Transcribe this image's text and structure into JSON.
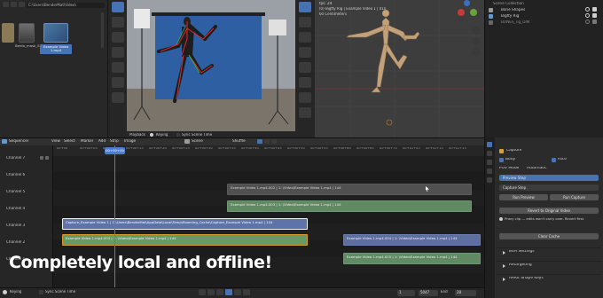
{
  "file_browser": {
    "path": "C:\\Users\\BenderMat\\Video\\",
    "items": [
      {
        "label": "",
        "kind": "folder"
      },
      {
        "label": "Bento_mask_Script",
        "kind": "file"
      },
      {
        "label": "Example Video 1.mp4",
        "kind": "video"
      }
    ]
  },
  "preview": {
    "playback_label": "Playback",
    "keying_label": "Keying",
    "sync_label": "Sync Scene Time"
  },
  "viewport3d": {
    "mode": "User Perspective",
    "line1": "fps: 24",
    "line2": "(0) Bigfty Rig | Example Video 1 | 010",
    "line3": "60 Centimeters"
  },
  "outliner": {
    "title": "Scene Collection",
    "items": [
      {
        "label": "Bone Shapes"
      },
      {
        "label": "Bigfty Rig"
      },
      {
        "label": "BONES_rig_DIM"
      }
    ]
  },
  "sequencer": {
    "editor_label": "Sequencer",
    "menus": [
      "View",
      "Select",
      "Marker",
      "Add",
      "Strip",
      "Image"
    ],
    "scene_label": "Scene",
    "shuffle_label": "Shuffle",
    "playhead_label": "00+00+00",
    "ruler_ticks": [
      "00+00",
      "00+00+05",
      "00+00+10",
      "00+00+15",
      "00+00+20",
      "00+00+25",
      "00+00+30",
      "00+00+35",
      "00+00+40",
      "00+00+45",
      "00+00+50",
      "00+00+55",
      "00+00+60",
      "00+00+65",
      "00+00+70",
      "00+01+05",
      "00+01+10",
      "00+01+15"
    ],
    "channels": [
      "Channel 7",
      "Channel 6",
      "Channel 5",
      "Channel 4",
      "Channel 3",
      "Channel 2",
      "Channel 1"
    ],
    "strips": [
      {
        "channel": 5,
        "start": 196,
        "end": 472,
        "style": "gray",
        "label": "Example Video 1.mp4.002 | 1: \\Video\\Example Video 1.mp4 | 144"
      },
      {
        "channel": 4,
        "start": 196,
        "end": 472,
        "style": "green",
        "label": "Example Video 1.mp4.003 | 1: \\Video\\Example Video 1.mp4 | 144"
      },
      {
        "channel": 3,
        "start": 10,
        "end": 287,
        "style": "blue-sel",
        "label": "Capture_Example Video 1 | C:\\Users\\BenderMat\\AppData\\Local\\Temp\\Roaming_Cache\\Capture_Example Video 1.mp4 | 144"
      },
      {
        "channel": 2,
        "start": 10,
        "end": 287,
        "style": "green-sel",
        "label": "Example Video 1.mp4.003 | 1: \\Video\\Example Video 1.mp4 | 144"
      },
      {
        "channel": 2,
        "start": 327,
        "end": 482,
        "style": "blue",
        "label": "Example Video 1.mp4.004 | 1: \\Video\\Example Video 1.mp4 | 144"
      },
      {
        "channel": 1,
        "start": 327,
        "end": 482,
        "style": "green",
        "label": "Example Video 1.mp4.005 | 1: \\Video\\Example Video 1.mp4 | 144"
      }
    ],
    "overlay_text": "Completely local and offline!"
  },
  "status_bar": {
    "keying_label": "Keying",
    "sync_label": "Sync Scene Time",
    "frame_start": "1",
    "frame_end": "5047",
    "start_label": "Start",
    "end_label": "End",
    "end_value": "28"
  },
  "side_panel": {
    "title": "Capture",
    "body_label": "Body",
    "face_label": "Face",
    "mode_label": "POV Mode",
    "mode_value": "Automatic",
    "preview_label": "Preview Step",
    "capture_step_label": "Capture Step",
    "run_preview_label": "Run Preview",
    "run_capture_label": "Run Capture",
    "revert_label": "Revert to Original Video",
    "note": "Proxy clip — edits won't carry over. Revert first.",
    "clear_cache_label": "Clear Cache",
    "sections": [
      "BVH Settings",
      "Retargeting",
      "ARKit Shape Keys"
    ]
  },
  "colors": {
    "accent": "#4772b3",
    "strip_green": "#5f8a63",
    "strip_blue": "#5d6f9e",
    "strip_gray": "#505050",
    "playhead": "#4a7fcf"
  }
}
